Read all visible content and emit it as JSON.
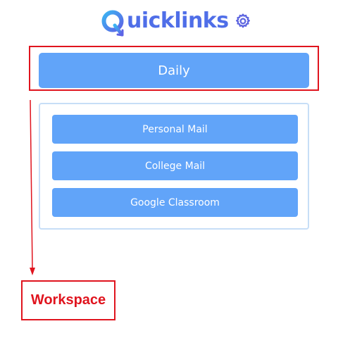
{
  "header": {
    "logo_text": "uicklinks",
    "logo_icon": "q-arrow-icon",
    "settings_icon": "gear-icon",
    "brand_color": "#4f6ee8"
  },
  "daily": {
    "label": "Daily"
  },
  "links": [
    {
      "label": "Personal Mail"
    },
    {
      "label": "College Mail"
    },
    {
      "label": "Google Classroom"
    }
  ],
  "annotation": {
    "label": "Workspace",
    "color": "#e0141e"
  },
  "colors": {
    "button": "#61a4f9",
    "panel_border": "#c7def7"
  }
}
